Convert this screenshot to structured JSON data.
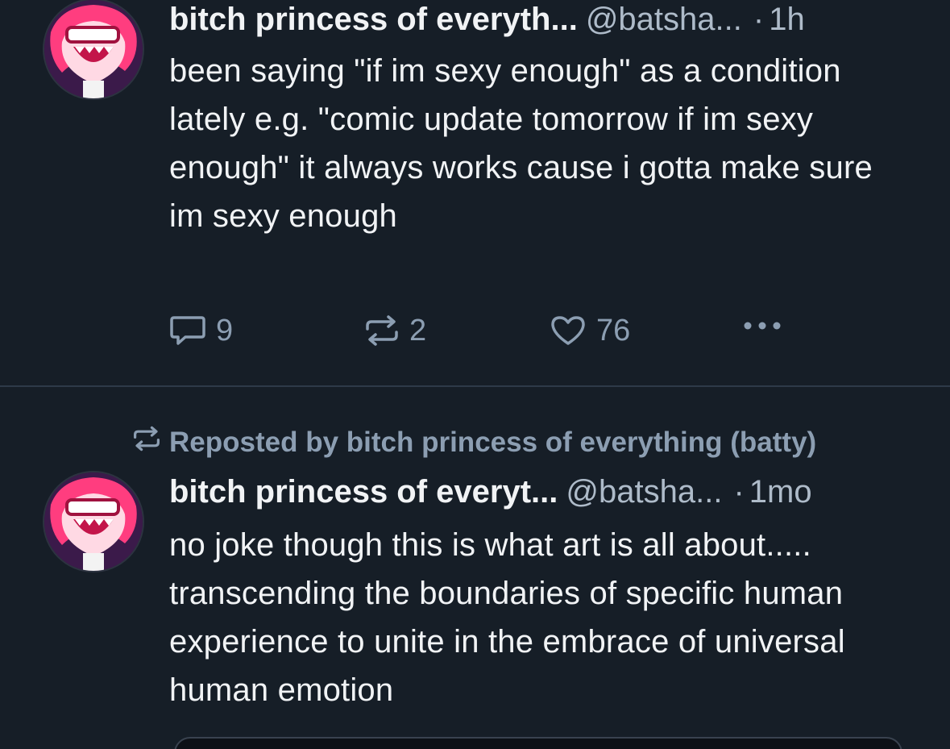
{
  "posts": [
    {
      "display_name": "bitch princess of everyth...",
      "handle": "@batsha...",
      "separator": "·",
      "time": "1h",
      "text": "been saying \"if im sexy enough\" as a condition lately e.g. \"comic update tomorrow if im sexy enough\" it always works cause i gotta make sure im sexy enough",
      "avatar_icon": "avatar-cartoon-pink-hair",
      "actions": {
        "replies": "9",
        "reposts": "2",
        "likes": "76",
        "reply_icon": "reply-icon",
        "repost_icon": "repost-icon",
        "like_icon": "heart-icon",
        "more_icon": "more-icon"
      }
    },
    {
      "repost_label": "Reposted by bitch princess of everything (batty)",
      "display_name": "bitch princess of everyt...",
      "handle": "@batsha...",
      "separator": "·",
      "time": "1mo",
      "text": "no joke though this is what art is all about..... transcending the boundaries of specific human experience to unite in the embrace of universal human emotion",
      "avatar_icon": "avatar-cartoon-pink-hair"
    }
  ],
  "colors": {
    "background": "#161e27",
    "text": "#f1f3f5",
    "muted": "#8c9eb2",
    "divider": "#2e3a48"
  }
}
